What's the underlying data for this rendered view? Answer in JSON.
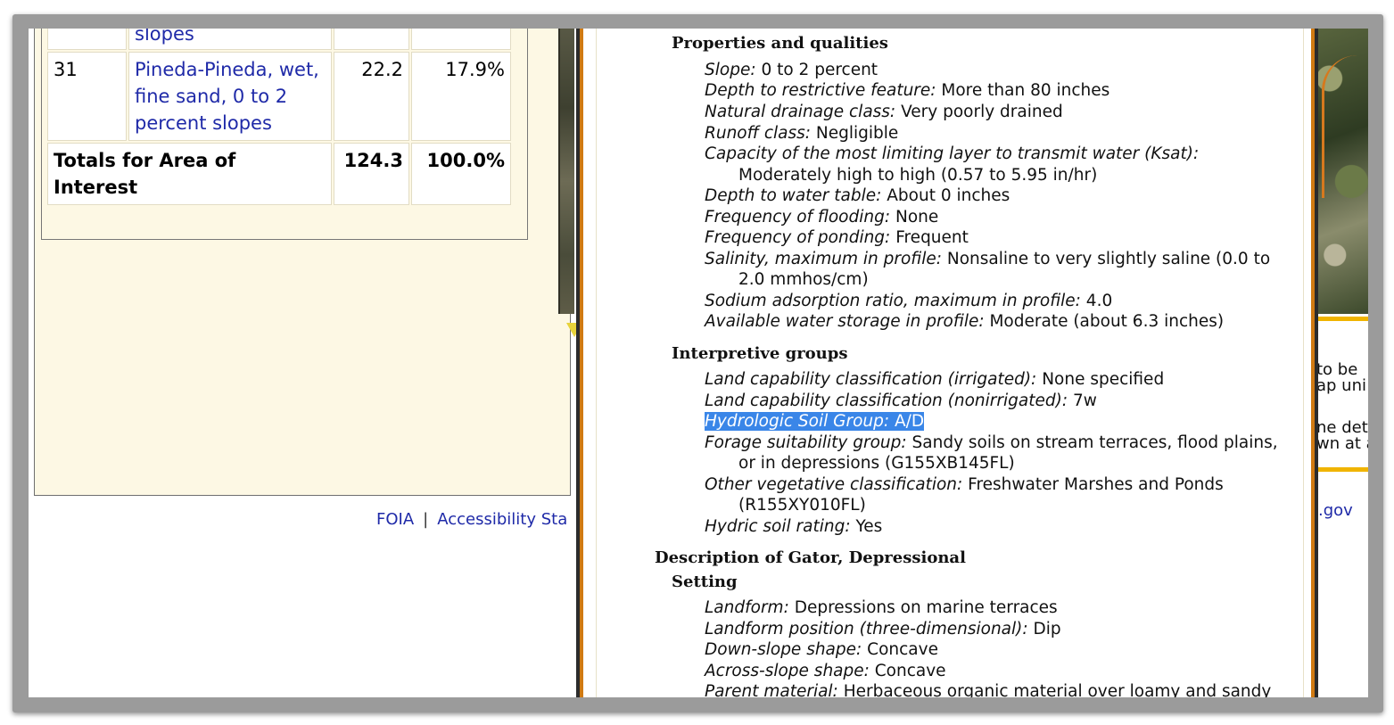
{
  "table": {
    "rows": [
      {
        "symbol": "",
        "name": "slopes",
        "acres": "",
        "percent": ""
      },
      {
        "symbol": "31",
        "name": "Pineda-Pineda, wet, fine sand, 0 to 2 percent slopes",
        "acres": "22.2",
        "percent": "17.9%"
      }
    ],
    "totals": {
      "label": "Totals for Area of Interest",
      "acres": "124.3",
      "percent": "100.0%"
    }
  },
  "footer": {
    "foia": "FOIA",
    "separator": "|",
    "accessibility": "Accessibility Sta"
  },
  "background_right": {
    "text_lines": [
      "to be",
      "ap uni",
      "ne deta",
      "wn at a"
    ],
    "link": ".gov"
  },
  "popup": {
    "properties": {
      "heading": "Properties and qualities",
      "items": [
        {
          "label": "Slope:",
          "value": "0 to 2 percent"
        },
        {
          "label": "Depth to restrictive feature:",
          "value": "More than 80 inches"
        },
        {
          "label": "Natural drainage class:",
          "value": "Very poorly drained"
        },
        {
          "label": "Runoff class:",
          "value": "Negligible"
        },
        {
          "label": "Capacity of the most limiting layer to transmit water (Ksat):",
          "value": "",
          "continuation": "Moderately high to high (0.57 to 5.95 in/hr)"
        },
        {
          "label": "Depth to water table:",
          "value": "About 0 inches"
        },
        {
          "label": "Frequency of flooding:",
          "value": "None"
        },
        {
          "label": "Frequency of ponding:",
          "value": "Frequent"
        },
        {
          "label": "Salinity, maximum in profile:",
          "value": "Nonsaline to very slightly saline (0.0 to",
          "continuation": "2.0 mmhos/cm)"
        },
        {
          "label": "Sodium adsorption ratio, maximum in profile:",
          "value": "4.0"
        },
        {
          "label": "Available water storage in profile:",
          "value": "Moderate (about 6.3 inches)"
        }
      ]
    },
    "interpretive": {
      "heading": "Interpretive groups",
      "items": [
        {
          "label": "Land capability classification (irrigated):",
          "value": "None specified"
        },
        {
          "label": "Land capability classification (nonirrigated):",
          "value": "7w"
        },
        {
          "label": "Hydrologic Soil Group:",
          "value": "A/D",
          "selected": true
        },
        {
          "label": "Forage suitability group:",
          "value": "Sandy soils on stream terraces, flood plains,",
          "continuation": "or in depressions (G155XB145FL)"
        },
        {
          "label": "Other vegetative classification:",
          "value": "Freshwater Marshes and Ponds",
          "continuation": "(R155XY010FL)"
        },
        {
          "label": "Hydric soil rating:",
          "value": "Yes"
        }
      ]
    },
    "description": {
      "heading": "Description of Gator, Depressional",
      "setting_heading": "Setting",
      "items": [
        {
          "label": "Landform:",
          "value": "Depressions on marine terraces"
        },
        {
          "label": "Landform position (three-dimensional):",
          "value": "Dip"
        },
        {
          "label": "Down-slope shape:",
          "value": "Concave"
        },
        {
          "label": "Across-slope shape:",
          "value": "Concave"
        },
        {
          "label": "Parent material:",
          "value": "Herbaceous organic material over loamy and sandy"
        }
      ]
    }
  },
  "colors": {
    "link": "#1f2aa8",
    "selection": "#3a86e8",
    "panel_bg": "#fdf8e4",
    "popup_border_orange": "#d07a12",
    "accent_gold": "#f0b400"
  }
}
